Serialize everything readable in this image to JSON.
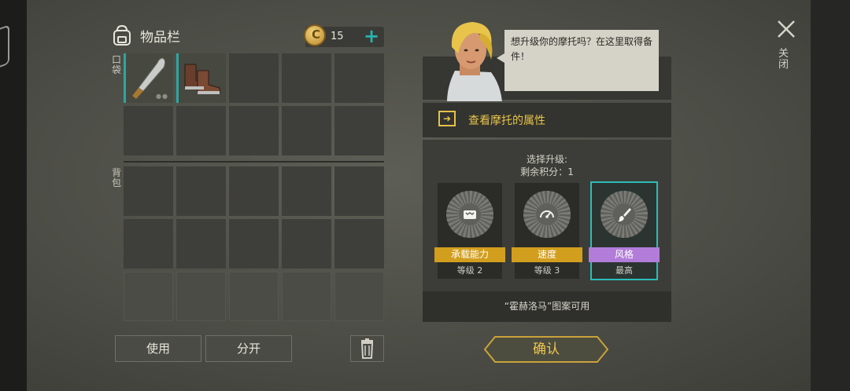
{
  "inventory": {
    "title": "物品栏",
    "coins": "15",
    "plus_symbol": "+",
    "pocket_label": "口袋",
    "backpack_label": "背包",
    "items": [
      {
        "name": "machete",
        "icon": "machete-icon"
      },
      {
        "name": "boots",
        "icon": "boots-icon"
      }
    ]
  },
  "buttons": {
    "use": "使用",
    "split": "分开",
    "confirm": "确认",
    "close": "关闭"
  },
  "dialog": {
    "speech": "想升级你的摩托吗？在这里取得备件！",
    "view_attributes": "查看摩托的属性"
  },
  "upgrade": {
    "title": "选择升级:",
    "points_label": "剩余积分：",
    "points": "1",
    "options": [
      {
        "label": "承载能力",
        "level": "等级 2",
        "icon": "cargo-icon",
        "color": "#d29e1e",
        "selected": false
      },
      {
        "label": "速度",
        "level": "等级 3",
        "icon": "speedometer-icon",
        "color": "#d29e1e",
        "selected": false
      },
      {
        "label": "风格",
        "level": "最高",
        "icon": "paint-brush-icon",
        "color": "#b27cd9",
        "selected": true
      }
    ],
    "note": "“霍赫洛马”图案可用"
  },
  "colors": {
    "accent_teal": "#2bbdba",
    "gold": "#e7c24a",
    "purple": "#b27cd9"
  }
}
